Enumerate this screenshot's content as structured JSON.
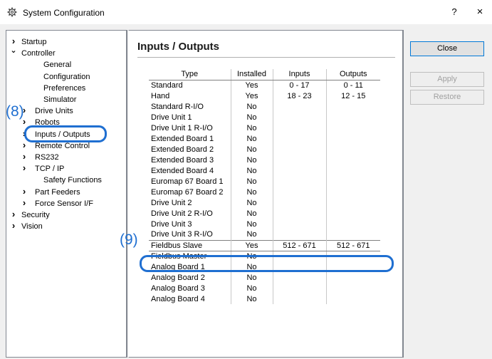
{
  "window": {
    "title": "System Configuration",
    "help": "?",
    "close": "×"
  },
  "tree": {
    "items": [
      {
        "label": "Startup",
        "arrow": "›"
      },
      {
        "label": "Controller",
        "arrow": "⌄"
      },
      {
        "label": "General"
      },
      {
        "label": "Configuration"
      },
      {
        "label": "Preferences"
      },
      {
        "label": "Simulator"
      },
      {
        "label": "Drive Units",
        "arrow": "›"
      },
      {
        "label": "Robots",
        "arrow": "›"
      },
      {
        "label": "Inputs / Outputs",
        "arrow": "›"
      },
      {
        "label": "Remote Control",
        "arrow": "›"
      },
      {
        "label": "RS232",
        "arrow": "›"
      },
      {
        "label": "TCP / IP",
        "arrow": "›"
      },
      {
        "label": "Safety Functions"
      },
      {
        "label": "Part Feeders",
        "arrow": "›"
      },
      {
        "label": "Force Sensor I/F",
        "arrow": "›"
      },
      {
        "label": "Security",
        "arrow": "›"
      },
      {
        "label": "Vision",
        "arrow": "›"
      }
    ]
  },
  "main": {
    "title": "Inputs / Outputs",
    "columns": [
      "Type",
      "Installed",
      "Inputs",
      "Outputs"
    ],
    "rows": [
      [
        "Standard",
        "Yes",
        "0 - 17",
        "0 - 11"
      ],
      [
        "Hand",
        "Yes",
        "18 - 23",
        "12 - 15"
      ],
      [
        "Standard R-I/O",
        "No",
        "",
        ""
      ],
      [
        "Drive Unit 1",
        "No",
        "",
        ""
      ],
      [
        "Drive Unit 1 R-I/O",
        "No",
        "",
        ""
      ],
      [
        "Extended Board 1",
        "No",
        "",
        ""
      ],
      [
        "Extended Board 2",
        "No",
        "",
        ""
      ],
      [
        "Extended Board 3",
        "No",
        "",
        ""
      ],
      [
        "Extended Board 4",
        "No",
        "",
        ""
      ],
      [
        "Euromap 67 Board 1",
        "No",
        "",
        ""
      ],
      [
        "Euromap 67 Board 2",
        "No",
        "",
        ""
      ],
      [
        "Drive Unit 2",
        "No",
        "",
        ""
      ],
      [
        "Drive Unit 2 R-I/O",
        "No",
        "",
        ""
      ],
      [
        "Drive Unit 3",
        "No",
        "",
        ""
      ],
      [
        "Drive Unit 3 R-I/O",
        "No",
        "",
        ""
      ],
      [
        "Fieldbus Slave",
        "Yes",
        "512 - 671",
        "512 - 671"
      ],
      [
        "Fieldbus Master",
        "No",
        "",
        ""
      ],
      [
        "Analog Board 1",
        "No",
        "",
        ""
      ],
      [
        "Analog Board 2",
        "No",
        "",
        ""
      ],
      [
        "Analog Board 3",
        "No",
        "",
        ""
      ],
      [
        "Analog Board 4",
        "No",
        "",
        ""
      ]
    ]
  },
  "buttons": {
    "close": "Close",
    "apply": "Apply",
    "restore": "Restore"
  },
  "annotations": {
    "a8": "(8)",
    "a9": "(9)",
    "color": "#1f6fd1"
  }
}
